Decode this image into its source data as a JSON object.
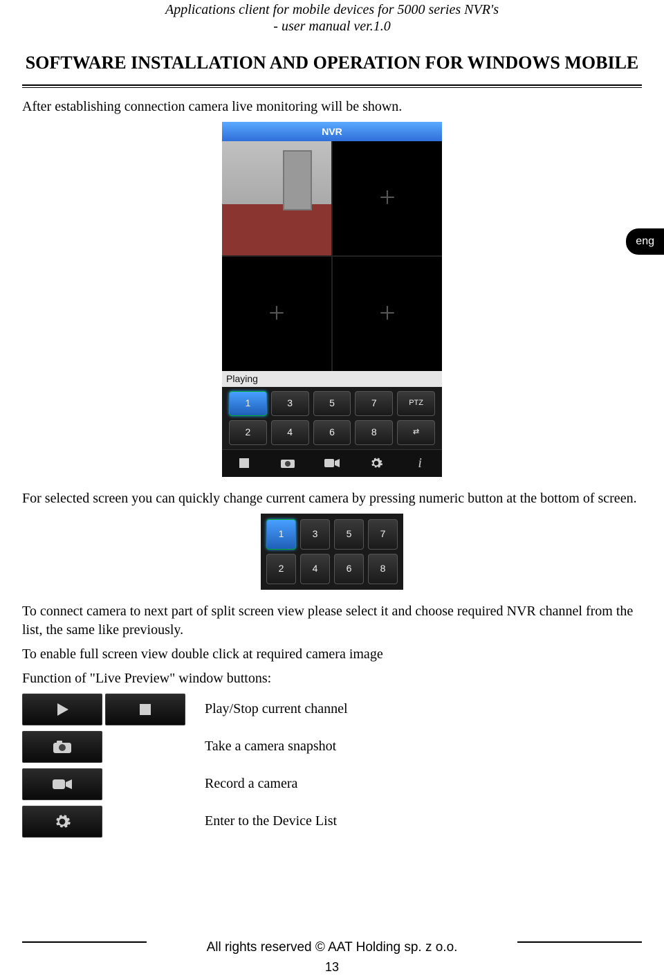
{
  "header": {
    "line1": "Applications client for mobile devices for 5000 series NVR's",
    "line2": "- user manual ver.1.0"
  },
  "section_title": "SOFTWARE INSTALLATION AND OPERATION FOR WINDOWS MOBILE",
  "lang_tab": "eng",
  "paragraphs": {
    "p1": "After establishing connection camera live monitoring will be shown.",
    "p2": "For selected screen you can quickly change current camera by pressing numeric button at the bottom of screen.",
    "p3": "To connect camera to next part of split screen view please select it and choose required NVR channel from the list, the same like previously.",
    "p4": "To enable full screen view double click at required camera image",
    "p5": "Function of \"Live Preview\" window buttons:"
  },
  "phone": {
    "title": "NVR",
    "status": "Playing",
    "keys_row1": [
      "1",
      "3",
      "5",
      "7",
      "PTZ"
    ],
    "keys_row2": [
      "2",
      "4",
      "6",
      "8",
      "⇄"
    ],
    "toolbar_icons": [
      "stop-icon",
      "camera-icon",
      "record-icon",
      "gear-icon",
      "info-icon"
    ]
  },
  "keypad_small": {
    "row1": [
      "1",
      "3",
      "5",
      "7"
    ],
    "row2": [
      "2",
      "4",
      "6",
      "8"
    ]
  },
  "functions": [
    {
      "icons": [
        "play-icon",
        "stop-icon"
      ],
      "label": "Play/Stop current channel"
    },
    {
      "icons": [
        "camera-icon"
      ],
      "label": "Take a camera snapshot"
    },
    {
      "icons": [
        "record-icon"
      ],
      "label": "Record a camera"
    },
    {
      "icons": [
        "gear-icon"
      ],
      "label": "Enter to the Device List"
    }
  ],
  "footer": "All rights reserved © AAT Holding sp. z o.o.",
  "page_number": "13"
}
